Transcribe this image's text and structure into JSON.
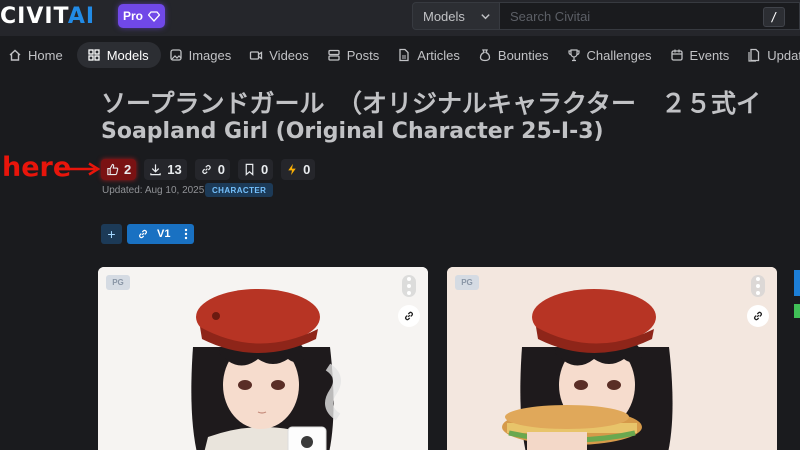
{
  "header": {
    "logo_main": "CIVIT",
    "logo_accent": "AI",
    "pro_label": "Pro",
    "search_category": "Models",
    "search_placeholder": "Search Civitai",
    "shortcut_key": "/"
  },
  "nav": {
    "items": [
      {
        "label": "Home",
        "icon": "home-icon"
      },
      {
        "label": "Models",
        "icon": "grid-icon"
      },
      {
        "label": "Images",
        "icon": "image-icon"
      },
      {
        "label": "Videos",
        "icon": "video-icon"
      },
      {
        "label": "Posts",
        "icon": "posts-icon"
      },
      {
        "label": "Articles",
        "icon": "article-icon"
      },
      {
        "label": "Bounties",
        "icon": "moneybag-icon"
      },
      {
        "label": "Challenges",
        "icon": "trophy-icon"
      },
      {
        "label": "Events",
        "icon": "calendar-icon"
      },
      {
        "label": "Updates",
        "icon": "updates-icon"
      }
    ],
    "active": "Models"
  },
  "model": {
    "title_jp": "ソープランドガール　（オリジナルキャラクター　２５式イ",
    "title_en": "Soapland Girl (Original Character 25-I-3)",
    "stats": {
      "likes": "2",
      "downloads": "13",
      "links": "0",
      "bookmarks": "0",
      "buzz": "0"
    },
    "updated": "Updated: Aug 10, 2025",
    "category": "CHARACTER",
    "version_label": "V1",
    "add_label": "+"
  },
  "annotation": {
    "text": "here"
  },
  "cards": [
    {
      "rating": "PG",
      "description": "girl in red beret holding a mug"
    },
    {
      "rating": "PG",
      "description": "girl in red beret eating a sandwich"
    }
  ],
  "colors": {
    "background": "#1a1b1e",
    "header": "#25262b",
    "accent_blue": "#228be6",
    "pro_purple": "#7048e8",
    "annotation_red": "#e8150b",
    "version_blue": "#1971c2"
  }
}
